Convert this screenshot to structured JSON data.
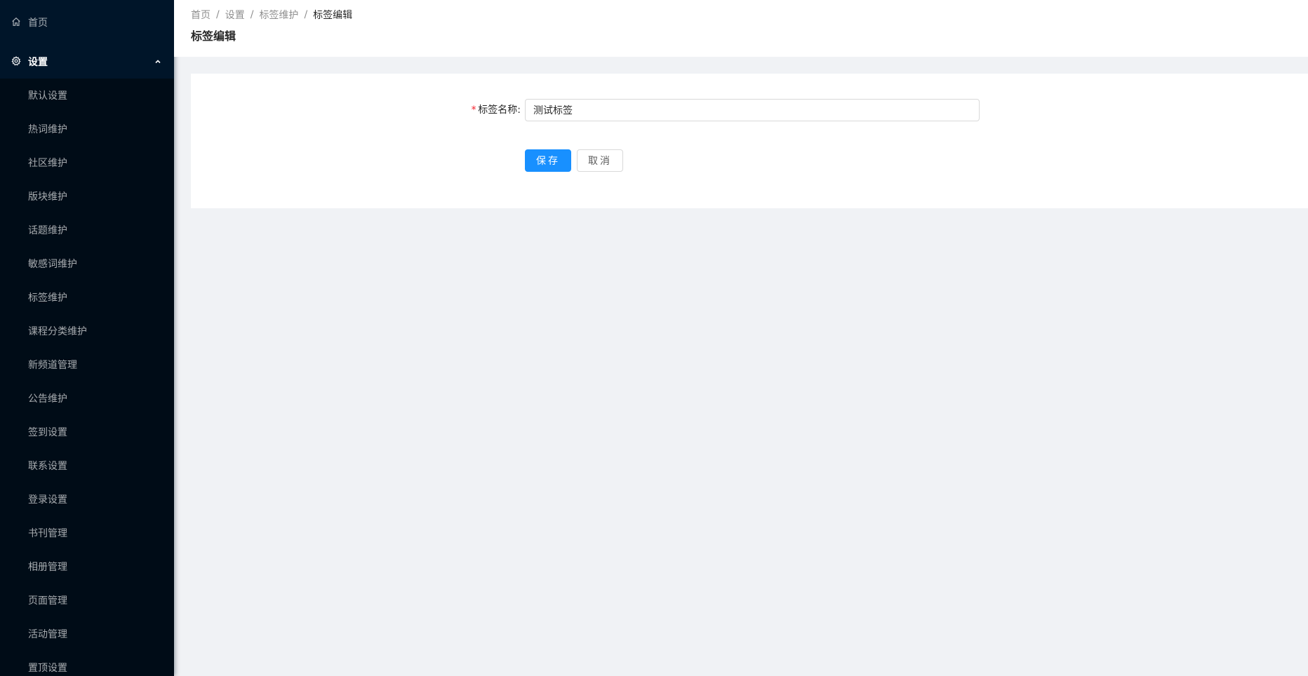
{
  "sidebar": {
    "home": {
      "label": "首页",
      "icon": "home-icon"
    },
    "settings": {
      "label": "设置",
      "icon": "gear-icon",
      "expanded": true
    },
    "items": [
      {
        "label": "默认设置"
      },
      {
        "label": "热词维护"
      },
      {
        "label": "社区维护"
      },
      {
        "label": "版块维护"
      },
      {
        "label": "话题维护"
      },
      {
        "label": "敏感词维护"
      },
      {
        "label": "标签维护"
      },
      {
        "label": "课程分类维护"
      },
      {
        "label": "新频道管理"
      },
      {
        "label": "公告维护"
      },
      {
        "label": "签到设置"
      },
      {
        "label": "联系设置"
      },
      {
        "label": "登录设置"
      },
      {
        "label": "书刊管理"
      },
      {
        "label": "相册管理"
      },
      {
        "label": "页面管理"
      },
      {
        "label": "活动管理"
      },
      {
        "label": "置顶设置"
      }
    ],
    "colors": {
      "bg": "#000c17",
      "header_bg": "#001529",
      "text": "#ffffffa6"
    }
  },
  "breadcrumb": [
    "首页",
    "设置",
    "标签维护",
    "标签编辑"
  ],
  "breadcrumb_separator": "/",
  "page_title": "标签编辑",
  "form": {
    "tag_name": {
      "required_mark": "*",
      "label": "标签名称:",
      "value": "测试标签",
      "placeholder": ""
    },
    "save_label": "保存",
    "cancel_label": "取消"
  },
  "colors": {
    "primary": "#1890ff",
    "required": "#f5222d"
  }
}
